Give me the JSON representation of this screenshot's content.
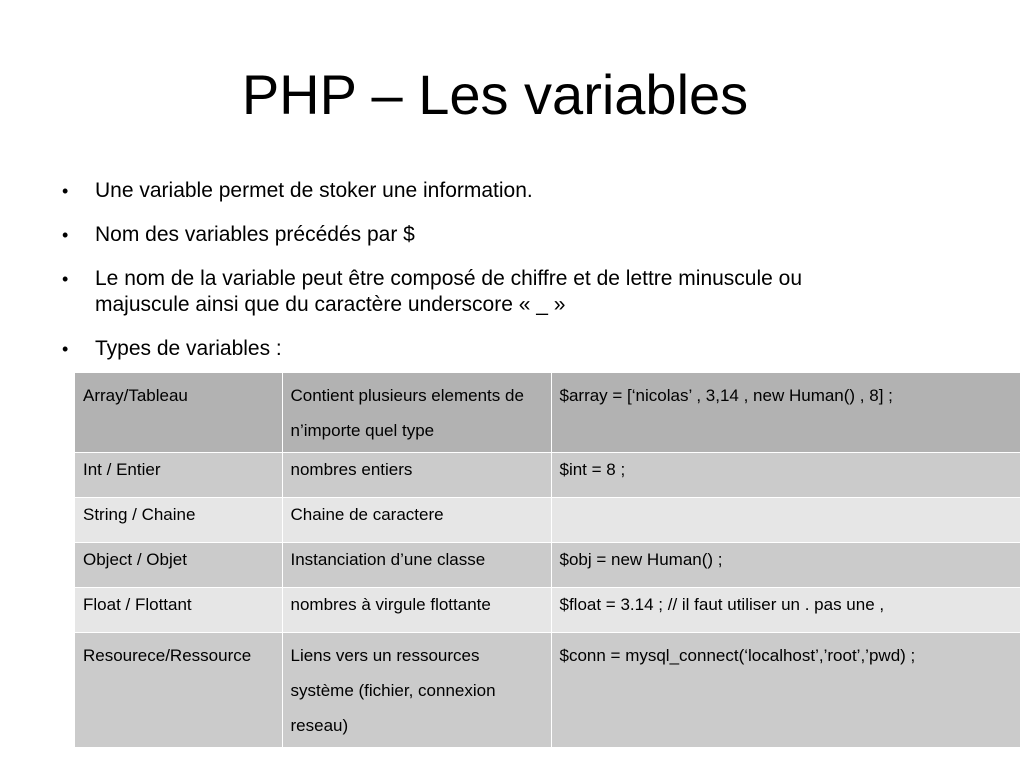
{
  "slide": {
    "title": "PHP – Les variables"
  },
  "bullets": [
    {
      "marker": "•",
      "text": "Une variable permet de stoker une information."
    },
    {
      "marker": "•",
      "text": "Nom des variables précédés par $"
    },
    {
      "marker": "•",
      "text_line1": "Le nom de la variable peut être composé de chiffre et de lettre minuscule ou",
      "text_line2": "majuscule ainsi que du caractère underscore « _ »"
    },
    {
      "marker": "•",
      "text": "Types de variables :"
    }
  ],
  "types_table": {
    "rows": [
      {
        "type": "Array/Tableau",
        "description": "Contient plusieurs elements de n’importe quel type",
        "example": "$array = [‘nicolas’ , 3,14 , new Human() , 8] ;"
      },
      {
        "type": "Int / Entier",
        "description": "nombres entiers",
        "example": "$int = 8 ;"
      },
      {
        "type": "String / Chaine",
        "description": "Chaine de caractere",
        "example": ""
      },
      {
        "type": "Object / Objet",
        "description": "Instanciation d’une classe",
        "example": "$obj = new Human() ;"
      },
      {
        "type": "Float / Flottant",
        "description": "nombres à virgule flottante",
        "example": "$float = 3.14 ; // il faut utiliser un . pas une ,"
      },
      {
        "type": "Resourece/Ressource",
        "description": "Liens vers un ressources système (fichier, connexion reseau)",
        "example": "$conn = mysql_connect(‘localhost’,’root’,’pwd) ;"
      }
    ]
  },
  "colors": {
    "header_row": "#b2b2b2",
    "dark_row": "#cbcbcb",
    "light_row": "#e6e6e6"
  }
}
